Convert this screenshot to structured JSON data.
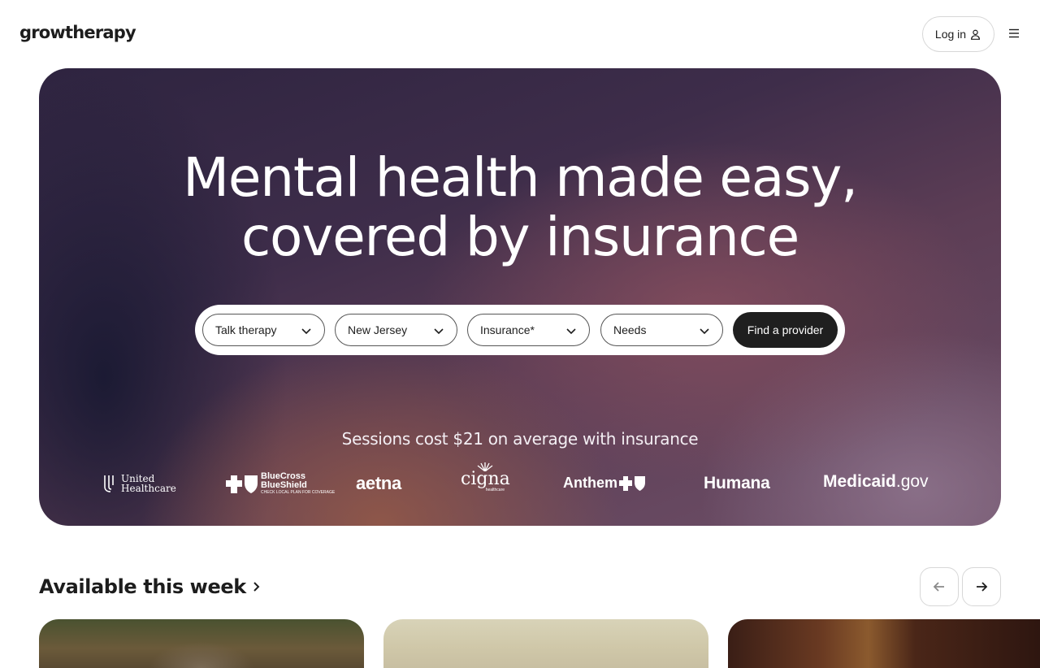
{
  "header": {
    "logo": "growtherapy",
    "login_label": "Log in"
  },
  "hero": {
    "title_line1": "Mental health made easy,",
    "title_line2": "covered by insurance",
    "filters": [
      {
        "label": "Talk therapy"
      },
      {
        "label": "New Jersey"
      },
      {
        "label": "Insurance*"
      },
      {
        "label": "Needs"
      }
    ],
    "find_button": "Find a provider",
    "sessions_text": "Sessions cost $21 on average with insurance",
    "insurers": [
      {
        "name": "United Healthcare",
        "line1": "United",
        "line2": "Healthcare"
      },
      {
        "name": "BlueCross BlueShield",
        "line1": "BlueCross",
        "line2": "BlueShield",
        "line3": "CHECK LOCAL PLAN FOR COVERAGE"
      },
      {
        "name": "aetna"
      },
      {
        "name": "cigna",
        "sub": "healthcare"
      },
      {
        "name": "Anthem"
      },
      {
        "name": "Humana"
      },
      {
        "name": "Medicaid",
        "suffix": ".gov"
      }
    ]
  },
  "available": {
    "title": "Available this week"
  },
  "colors": {
    "button_dark": "#1f1f1f",
    "text": "#1d1d1d"
  }
}
